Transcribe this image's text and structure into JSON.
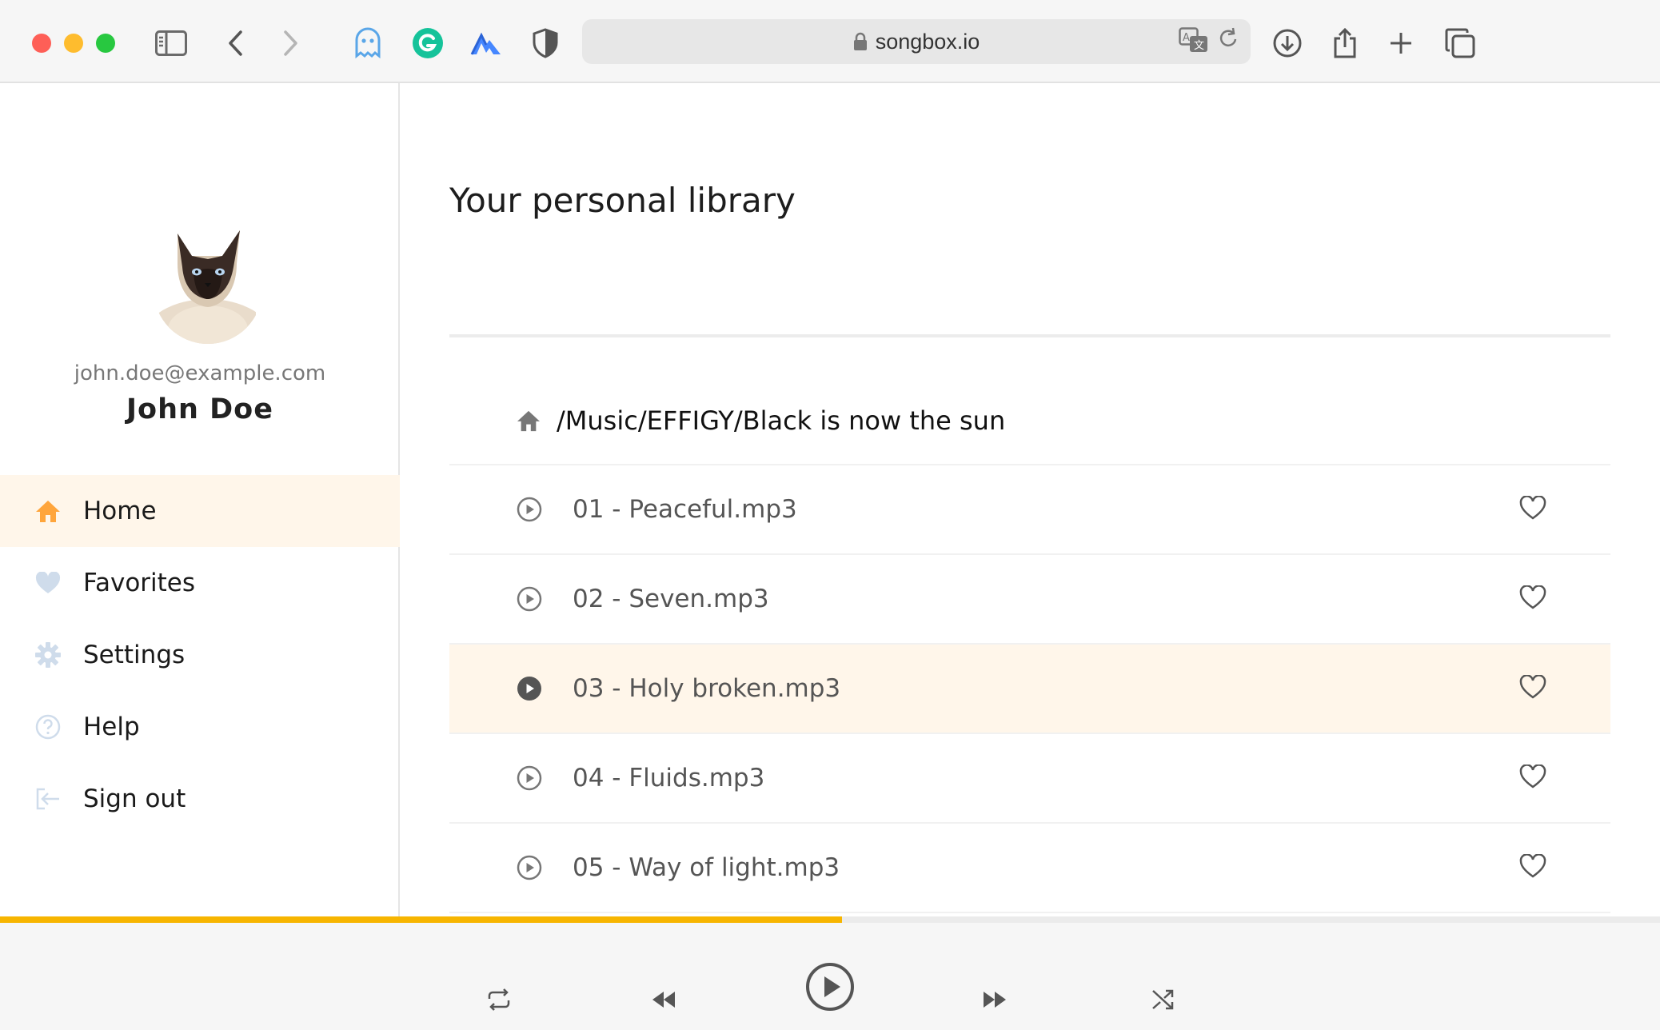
{
  "browser": {
    "url": "songbox.io",
    "icons": [
      "sidebar-icon",
      "back-icon",
      "forward-icon",
      "ghost-extension-icon",
      "grammarly-extension-icon",
      "nordvpn-extension-icon",
      "shield-extension-icon",
      "translate-icon",
      "reload-icon",
      "download-icon",
      "share-icon",
      "new-tab-icon",
      "tabs-overview-icon"
    ]
  },
  "user": {
    "email": "john.doe@example.com",
    "name": "John Doe"
  },
  "nav": {
    "items": [
      {
        "label": "Home",
        "icon": "home-icon",
        "active": true
      },
      {
        "label": "Favorites",
        "icon": "heart-icon",
        "active": false
      },
      {
        "label": "Settings",
        "icon": "gear-icon",
        "active": false
      },
      {
        "label": "Help",
        "icon": "help-icon",
        "active": false
      },
      {
        "label": "Sign out",
        "icon": "sign-out-icon",
        "active": false
      }
    ]
  },
  "main": {
    "title": "Your personal library",
    "path": "/Music/EFFIGY/Black is now the sun",
    "tracks": [
      {
        "name": "01 - Peaceful.mp3",
        "playing": false
      },
      {
        "name": "02 - Seven.mp3",
        "playing": false
      },
      {
        "name": "03 - Holy broken.mp3",
        "playing": true
      },
      {
        "name": "04 - Fluids.mp3",
        "playing": false
      },
      {
        "name": "05 - Way of light.mp3",
        "playing": false
      }
    ]
  },
  "player": {
    "progress": 0.507,
    "controls": [
      "repeat-icon",
      "rewind-icon",
      "play-icon",
      "fast-forward-icon",
      "shuffle-icon"
    ]
  },
  "colors": {
    "accent": "#f7b500",
    "home_icon": "#ffa53b",
    "active_bg": "#fff6ea"
  }
}
